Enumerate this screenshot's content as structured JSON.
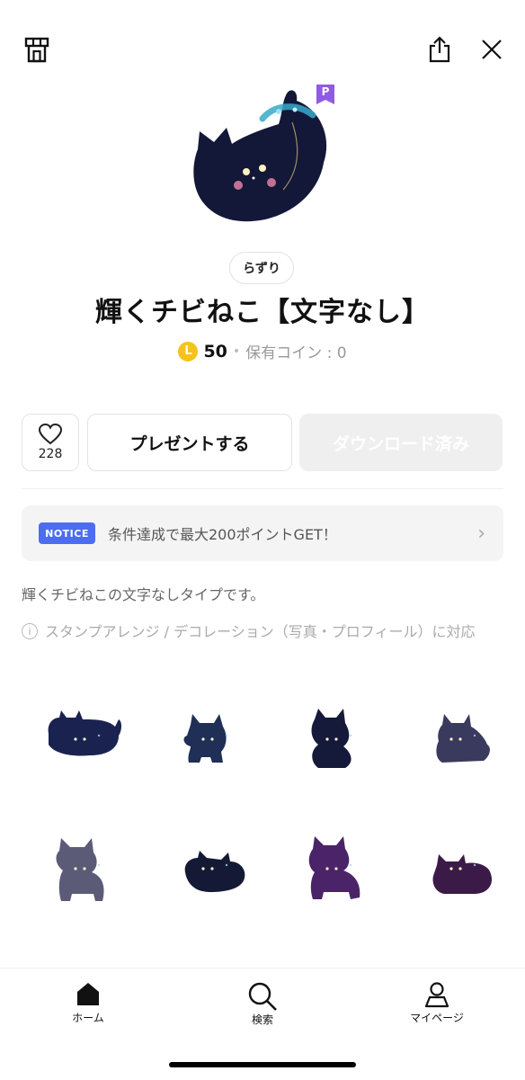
{
  "header": {
    "shop_icon": "shop-icon",
    "share_icon": "share-icon",
    "close_icon": "close-icon"
  },
  "product": {
    "premium_badge": "P",
    "author": "らずり",
    "title": "輝くチビねこ【文字なし】",
    "coin_symbol": "L",
    "price": "50",
    "separator": "•",
    "owned_coins": "保有コイン : 0",
    "description": "輝くチビねこの文字なしタイプです。",
    "arrange_info": "スタンプアレンジ / デコレーション（写真・プロフィール）に対応",
    "info_icon_text": "i"
  },
  "actions": {
    "like_count": "228",
    "present_label": "プレゼントする",
    "download_label": "ダウンロード済み"
  },
  "notice": {
    "badge": "NOTICE",
    "text": "条件達成で最大200ポイントGET！",
    "chevron": "›"
  },
  "stickers": [
    {
      "name": "sticker-1",
      "color": "#1a2350"
    },
    {
      "name": "sticker-2",
      "color": "#1f2f55"
    },
    {
      "name": "sticker-3",
      "color": "#151a3a"
    },
    {
      "name": "sticker-4",
      "color": "#3a3a5e"
    },
    {
      "name": "sticker-5",
      "color": "#5b5b78"
    },
    {
      "name": "sticker-6",
      "color": "#141a36"
    },
    {
      "name": "sticker-7",
      "color": "#4a2368"
    },
    {
      "name": "sticker-8",
      "color": "#3b1a48"
    }
  ],
  "tabbar": {
    "home": "ホーム",
    "search": "検索",
    "mypage": "マイページ"
  },
  "colors": {
    "accent_notice": "#4d6df0",
    "coin": "#f6c21c",
    "premium": "#8f5ae8",
    "cat_body": "#131838"
  }
}
